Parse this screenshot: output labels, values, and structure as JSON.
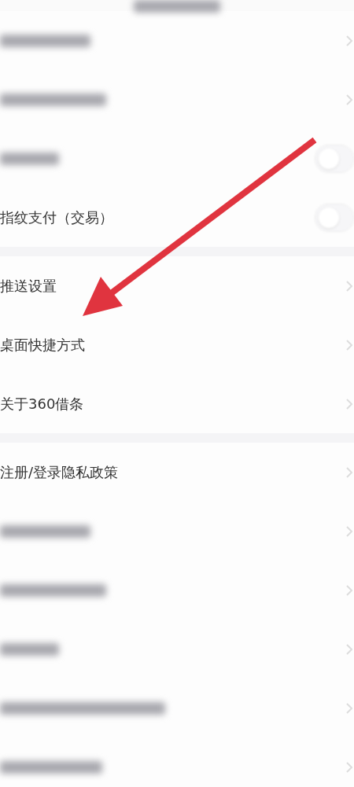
{
  "header": {
    "title_blurred": true
  },
  "sections": [
    {
      "rows": [
        {
          "kind": "link",
          "blurred": true
        },
        {
          "kind": "link",
          "blurred": true
        },
        {
          "kind": "toggle",
          "blurred": true,
          "on": false
        },
        {
          "kind": "toggle",
          "blurred": false,
          "label": "指纹支付（交易）",
          "on": false
        }
      ]
    },
    {
      "rows": [
        {
          "kind": "link",
          "blurred": false,
          "label": "推送设置"
        },
        {
          "kind": "link",
          "blurred": false,
          "label": "桌面快捷方式"
        },
        {
          "kind": "link",
          "blurred": false,
          "label": "关于360借条"
        }
      ]
    },
    {
      "rows": [
        {
          "kind": "link",
          "blurred": false,
          "label": "注册/登录隐私政策"
        },
        {
          "kind": "link",
          "blurred": true
        },
        {
          "kind": "link",
          "blurred": true
        },
        {
          "kind": "link",
          "blurred": true
        },
        {
          "kind": "link",
          "blurred": true
        },
        {
          "kind": "link",
          "blurred": true
        }
      ]
    }
  ],
  "annotation": {
    "kind": "arrow"
  }
}
